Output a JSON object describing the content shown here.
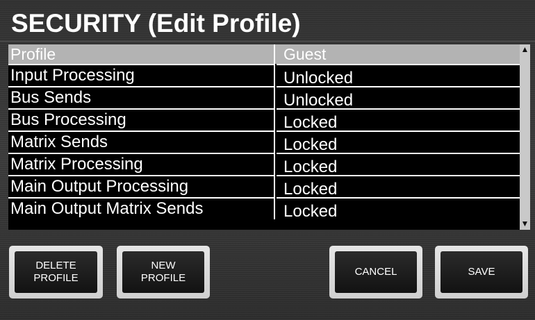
{
  "title": "SECURITY (Edit Profile)",
  "table": {
    "header": {
      "col1": "Profile",
      "col2": "Guest"
    },
    "rows": [
      {
        "name": "Input Processing",
        "status": "Unlocked"
      },
      {
        "name": "Bus Sends",
        "status": "Unlocked"
      },
      {
        "name": "Bus Processing",
        "status": "Locked"
      },
      {
        "name": "Matrix Sends",
        "status": "Locked"
      },
      {
        "name": "Matrix Processing",
        "status": "Locked"
      },
      {
        "name": "Main Output Processing",
        "status": "Locked"
      },
      {
        "name": "Main Output Matrix Sends",
        "status": "Locked"
      }
    ]
  },
  "scrollbar": {
    "up_icon": "arrow-up-icon",
    "down_icon": "arrow-down-icon"
  },
  "buttons": {
    "delete_profile": "DELETE\nPROFILE",
    "new_profile": "NEW\nPROFILE",
    "cancel": "CANCEL",
    "save": "SAVE"
  },
  "colors": {
    "header_bg": "#b3b3b3",
    "table_bg": "#000000",
    "text": "#ffffff",
    "button_frame": "#d9d9d9"
  }
}
